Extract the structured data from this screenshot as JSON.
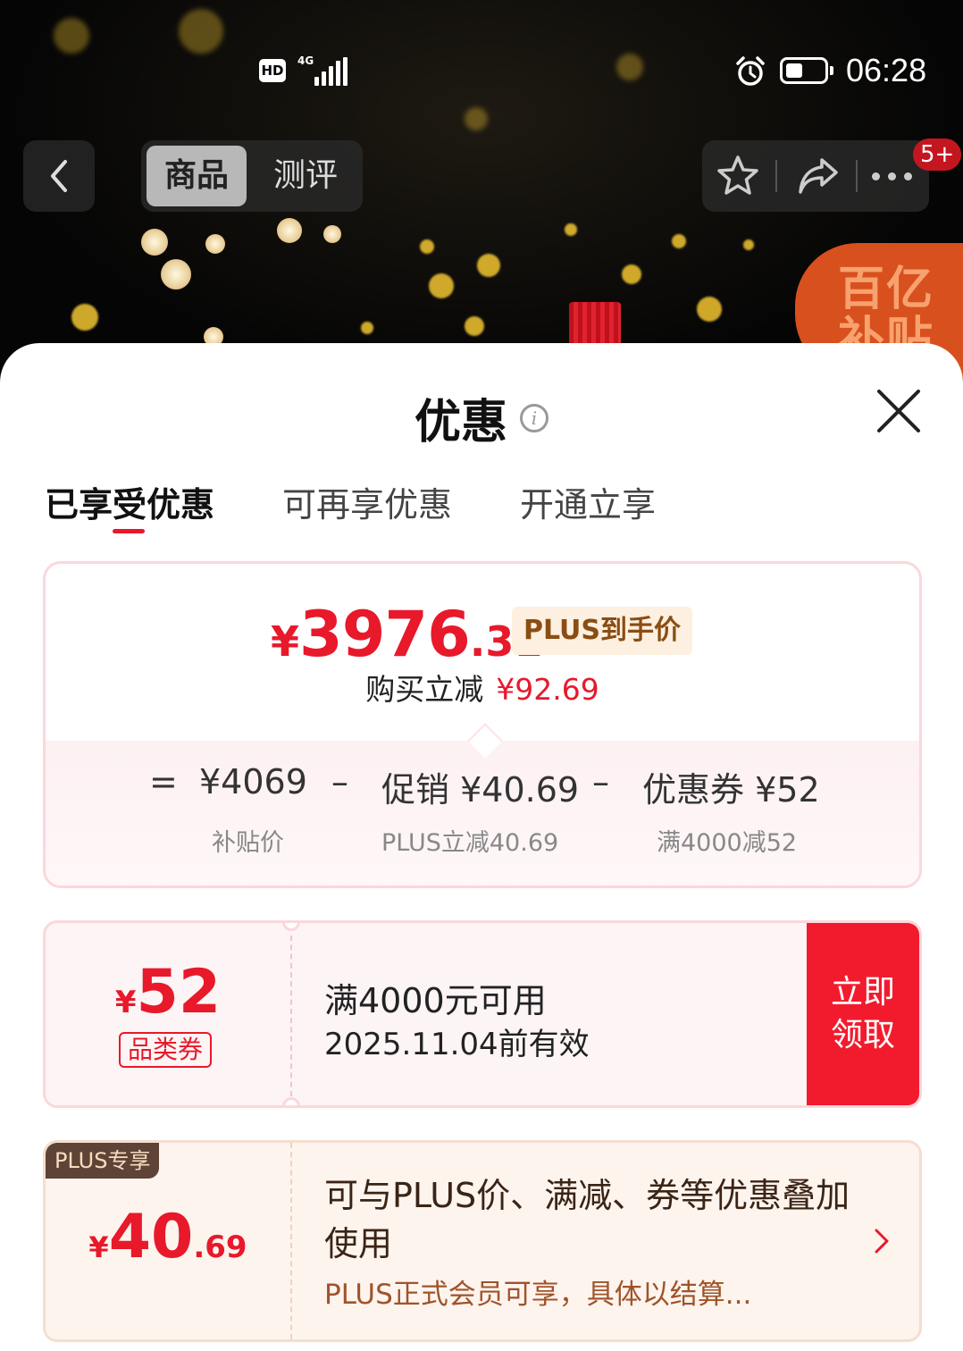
{
  "status_bar": {
    "hd_label": "HD",
    "network_label": "4G",
    "signal_icon": "signal-bars-icon",
    "alarm_icon": "alarm-clock-icon",
    "battery_icon": "battery-icon",
    "battery_level": 0.45,
    "time": "06:28"
  },
  "nav": {
    "back_icon": "chevron-left-icon",
    "tabs": [
      {
        "label": "商品",
        "active": true
      },
      {
        "label": "测评",
        "active": false
      }
    ],
    "favorite_icon": "star-outline-icon",
    "share_icon": "share-arrow-icon",
    "more_icon": "more-dots-icon",
    "message_badge": "5+"
  },
  "banner": {
    "subsidy_text_line1": "百亿",
    "subsidy_text_line2": "补贴"
  },
  "sheet": {
    "title": "优惠",
    "info_icon": "info-icon",
    "close_icon": "close-x-icon",
    "tabs": [
      {
        "label": "已享受优惠",
        "active": true
      },
      {
        "label": "可再享优惠",
        "active": false
      },
      {
        "label": "开通立享",
        "active": false
      }
    ]
  },
  "price_summary": {
    "currency": "¥",
    "final_int": "3976",
    "final_dec": ".31",
    "final_tag": "PLUS到手价",
    "instant_off_label": "购买立减",
    "instant_off_value": "¥92.69",
    "equals": "=",
    "base_price": "¥4069",
    "base_label": "补贴价",
    "minus1": "–",
    "promo_label": "促销",
    "promo_value": "¥40.69",
    "promo_sub": "PLUS立减40.69",
    "minus2": "–",
    "coupon_label": "优惠券",
    "coupon_value": "¥52",
    "coupon_sub": "满4000减52"
  },
  "coupon": {
    "currency": "¥",
    "amount": "52",
    "type": "品类券",
    "condition": "满4000元可用",
    "validity": "2025.11.04前有效",
    "claim_line1": "立即",
    "claim_line2": "领取"
  },
  "plus_offer": {
    "label": "PLUS专享",
    "currency": "¥",
    "amount_int": "40",
    "amount_dec": ".69",
    "description": "可与PLUS价、满减、券等优惠叠加使用",
    "note": "PLUS正式会员可享，具体以结算...",
    "chevron_icon": "chevron-right-icon"
  },
  "colors": {
    "accent_red": "#e7192b",
    "claim_button": "#f21b2e",
    "plus_brown": "#5d4436"
  }
}
